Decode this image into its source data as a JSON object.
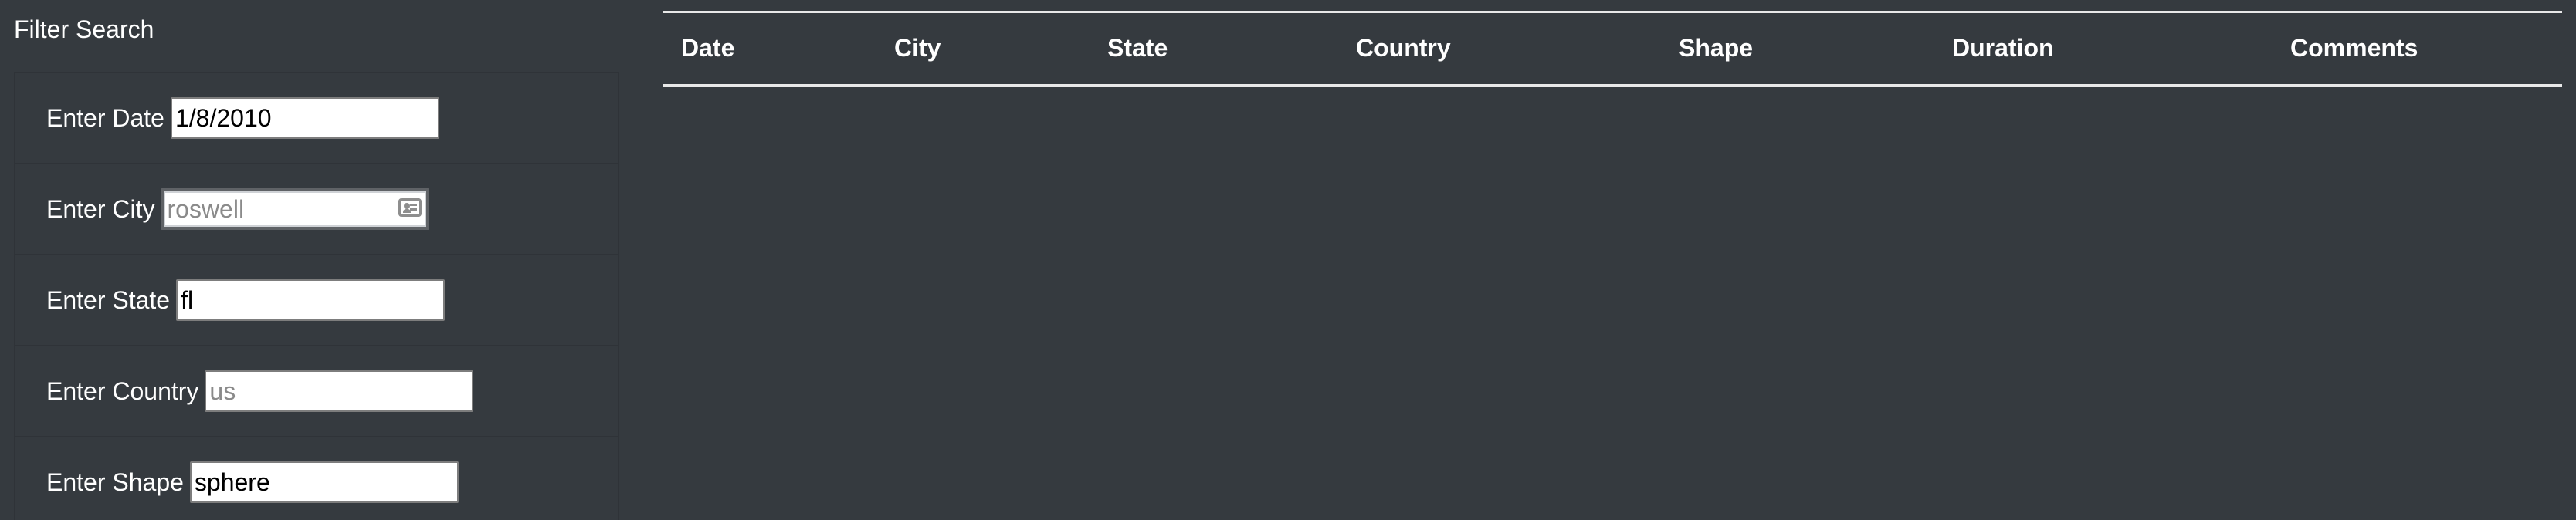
{
  "filter": {
    "heading": "Filter Search",
    "fields": [
      {
        "label": "Enter Date",
        "value": "1/8/2010",
        "placeholder": ""
      },
      {
        "label": "Enter City",
        "value": "",
        "placeholder": "roswell"
      },
      {
        "label": "Enter State",
        "value": "fl",
        "placeholder": ""
      },
      {
        "label": "Enter Country",
        "value": "",
        "placeholder": "us"
      },
      {
        "label": "Enter Shape",
        "value": "sphere",
        "placeholder": ""
      }
    ]
  },
  "table": {
    "columns": [
      "Date",
      "City",
      "State",
      "Country",
      "Shape",
      "Duration",
      "Comments"
    ],
    "rows": []
  },
  "colors": {
    "background": "#353a3f",
    "text": "#ffffff",
    "rule": "#e8e8e8",
    "input_background": "#ffffff"
  },
  "icons": {
    "city_input_icon": "contact-card-icon"
  }
}
